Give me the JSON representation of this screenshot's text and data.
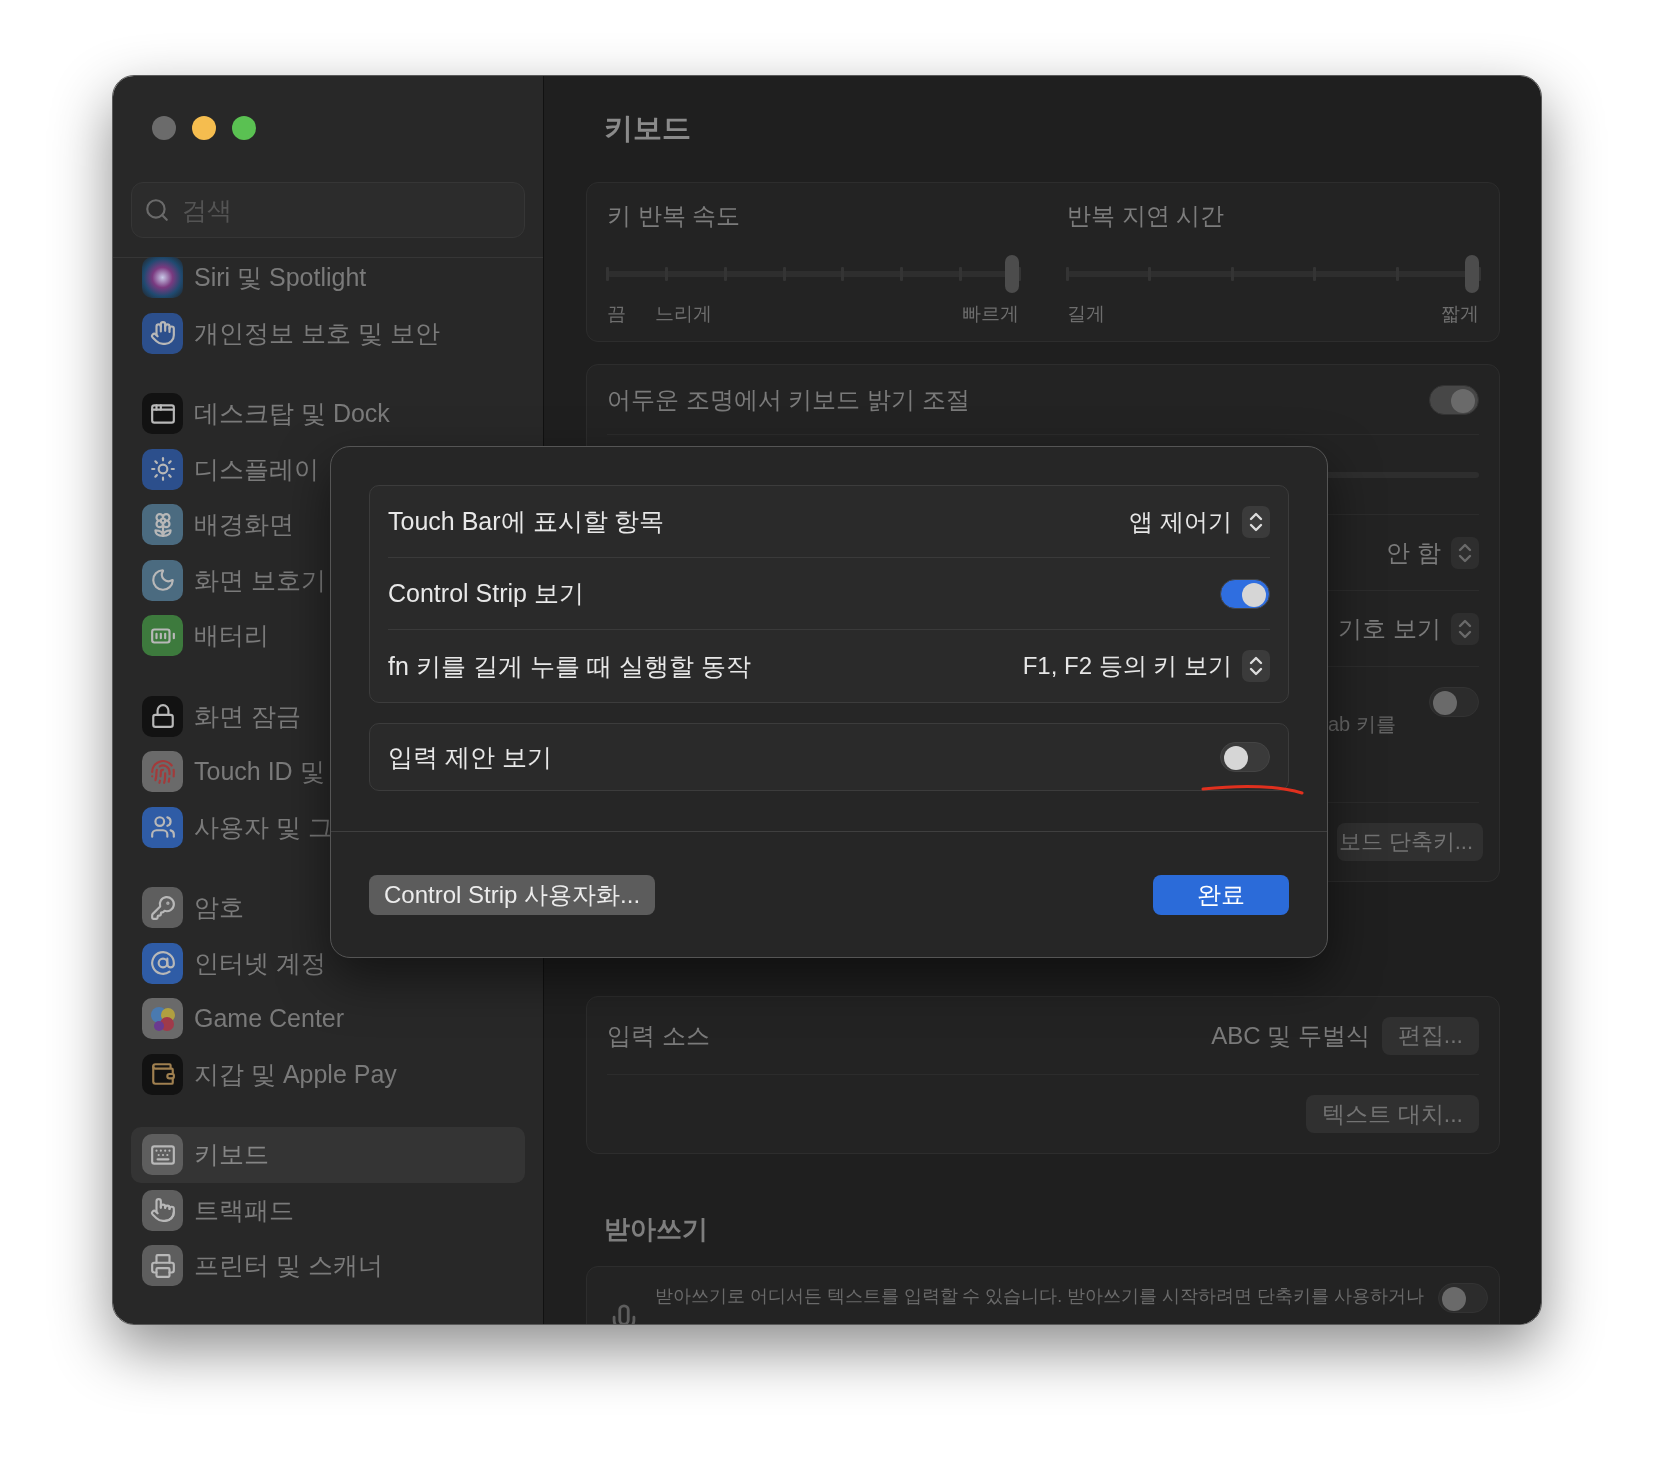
{
  "sidebar": {
    "search": {
      "placeholder": "검색"
    },
    "groups": [
      [
        {
          "label": "Siri 및 Spotlight",
          "selected": false
        },
        {
          "label": "개인정보 보호 및 보안",
          "selected": false
        }
      ],
      [
        {
          "label": "데스크탑 및 Dock",
          "selected": false
        },
        {
          "label": "디스플레이",
          "selected": false
        },
        {
          "label": "배경화면",
          "selected": false
        },
        {
          "label": "화면 보호기",
          "selected": false
        },
        {
          "label": "배터리",
          "selected": false
        }
      ],
      [
        {
          "label": "화면 잠금",
          "selected": false
        },
        {
          "label": "Touch ID 및",
          "selected": false
        },
        {
          "label": "사용자 및 그",
          "selected": false
        }
      ],
      [
        {
          "label": "암호",
          "selected": false
        },
        {
          "label": "인터넷 계정",
          "selected": false
        },
        {
          "label": "Game Center",
          "selected": false
        },
        {
          "label": "지갑 및 Apple Pay",
          "selected": false
        }
      ],
      [
        {
          "label": "키보드",
          "selected": true
        },
        {
          "label": "트랙패드",
          "selected": false
        },
        {
          "label": "프린터 및 스캐너",
          "selected": false
        }
      ]
    ]
  },
  "content": {
    "title": "키보드",
    "repeat_card": [
      {
        "label": "키 반복 속도",
        "level": 1,
        "scale": [
          "끔",
          "느리게",
          "빠르게"
        ]
      },
      {
        "label": "반복 지연 시간",
        "level": 1,
        "scale": [
          "길게",
          "짧게"
        ]
      }
    ],
    "backlight_card": [
      {
        "kind": "toggle",
        "label": "어두운 조명에서 키보드 밝기 조절",
        "on": true
      },
      {
        "kind": "slider"
      },
      {
        "kind": "popup",
        "value": "안 함"
      },
      {
        "kind": "popup",
        "value": "기호 보기"
      },
      {
        "kind": "toggle",
        "on": false,
        "note": "ab 키를"
      },
      {
        "kind": "button",
        "button": "보드 단축키..."
      }
    ],
    "input_card": [
      {
        "kind": "value_button",
        "label": "입력 소스",
        "value": "ABC 및 두벌식",
        "button": "편집..."
      },
      {
        "kind": "button",
        "button": "텍스트 대치..."
      }
    ],
    "dictation": {
      "heading": "받아쓰기",
      "description": "받아쓰기로 어디서든 텍스트를 입력할 수 있습니다. 받아쓰기를 시작하려면 단축키를 사용하거나",
      "on": false
    }
  },
  "sheet": {
    "groups": [
      [
        {
          "kind": "popup",
          "label": "Touch Bar에 표시할 항목",
          "value": "앱 제어기"
        },
        {
          "kind": "toggle",
          "label": "Control Strip 보기",
          "on": true
        },
        {
          "kind": "popup",
          "label": "fn 키를 길게 누를 때 실행할 동작",
          "value": "F1, F2 등의 키 보기"
        }
      ],
      [
        {
          "kind": "toggle",
          "label": "입력 제안 보기",
          "on": false
        }
      ]
    ],
    "buttons": [
      {
        "kind": "secondary",
        "label": "Control Strip 사용자화..."
      },
      {
        "kind": "primary",
        "label": "완료"
      }
    ]
  }
}
